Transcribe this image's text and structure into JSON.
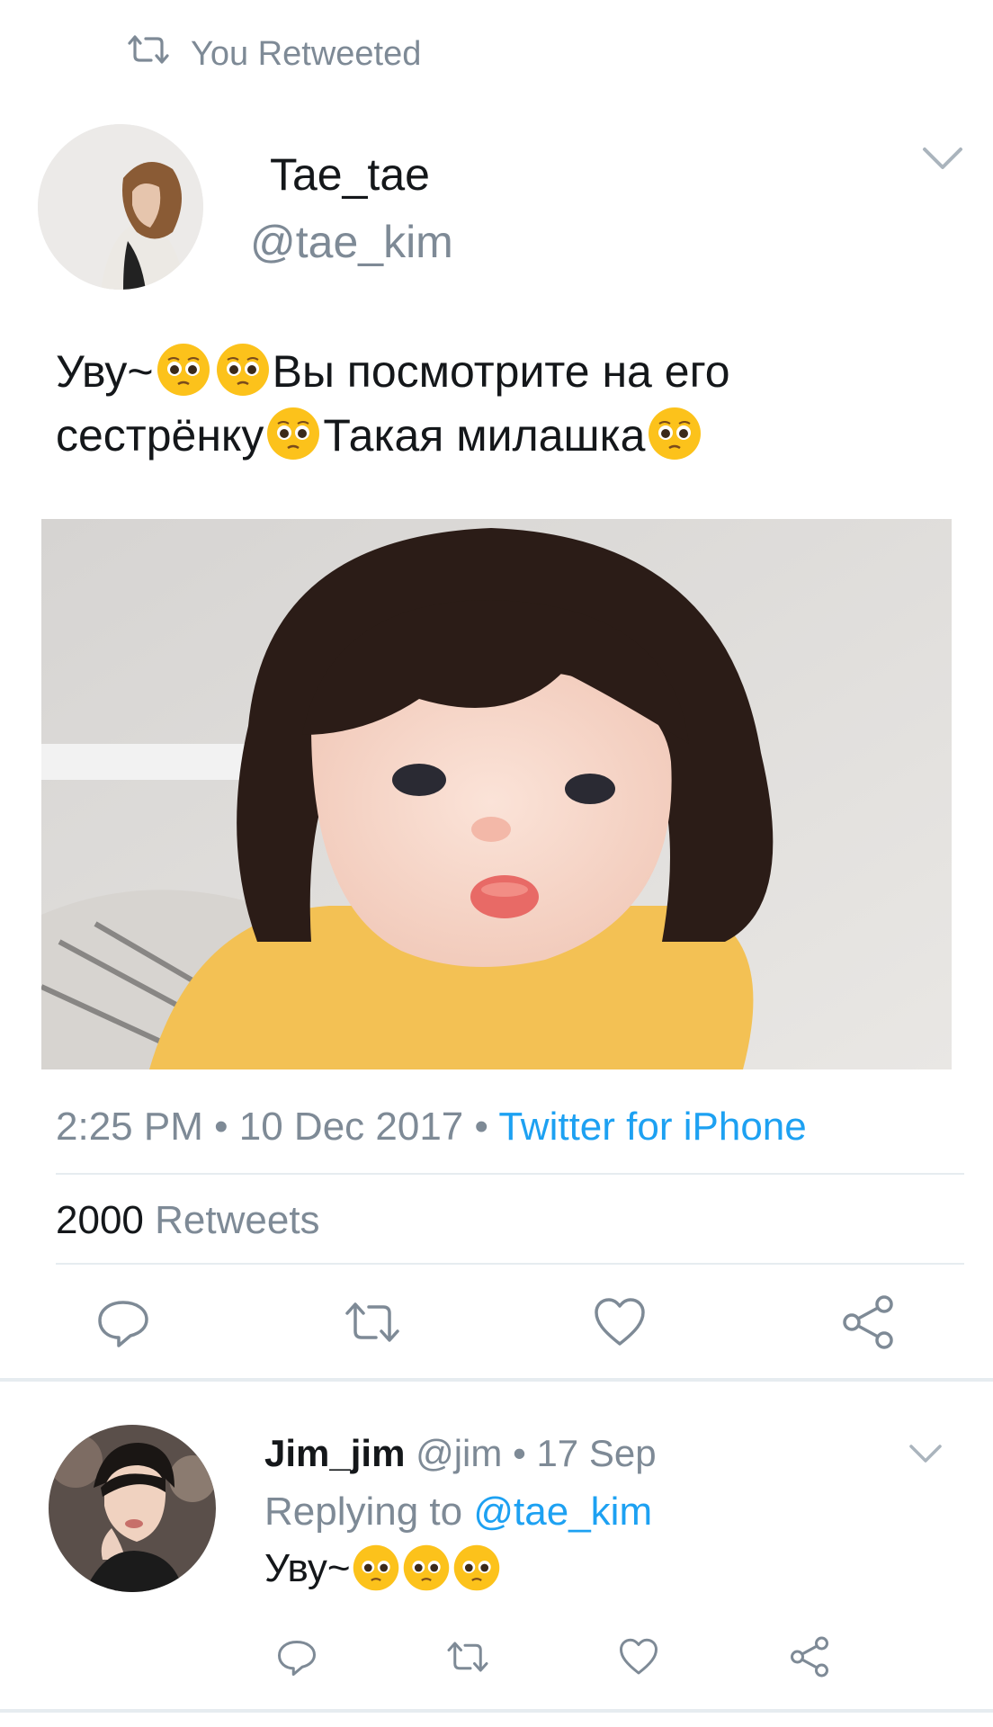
{
  "retweet_banner": {
    "text": "You Retweeted",
    "icon": "retweet-icon"
  },
  "tweet": {
    "display_name": "Tae_tae",
    "handle": "@tae_kim",
    "text_parts": {
      "p1": "Уву~",
      "p2": "Вы посмотрите на его",
      "p3": "сестрёнку",
      "p4": "Такая милашка"
    },
    "emoji": "pleading-face-emoji",
    "image_alt": "photo of a little girl with a bob haircut pouting in a yellow top",
    "time": "2:25 PM",
    "date": "10 Dec 2017",
    "separator": "•",
    "source": "Twitter for iPhone",
    "retweet_count": "2000",
    "retweet_label": "Retweets",
    "actions": [
      "reply-icon",
      "retweet-icon",
      "like-icon",
      "share-icon"
    ]
  },
  "reply": {
    "display_name": "Jim_jim",
    "handle": "@jim",
    "separator": "•",
    "date": "17 Sep",
    "replying_prefix": "Replying to",
    "replying_to": "@tae_kim",
    "text": "Уву~",
    "actions": [
      "reply-icon",
      "retweet-icon",
      "like-icon",
      "share-icon"
    ]
  },
  "colors": {
    "accent": "#1da1f2",
    "muted": "#7e8a96",
    "text": "#14171a",
    "divider": "#e6ecf0"
  }
}
